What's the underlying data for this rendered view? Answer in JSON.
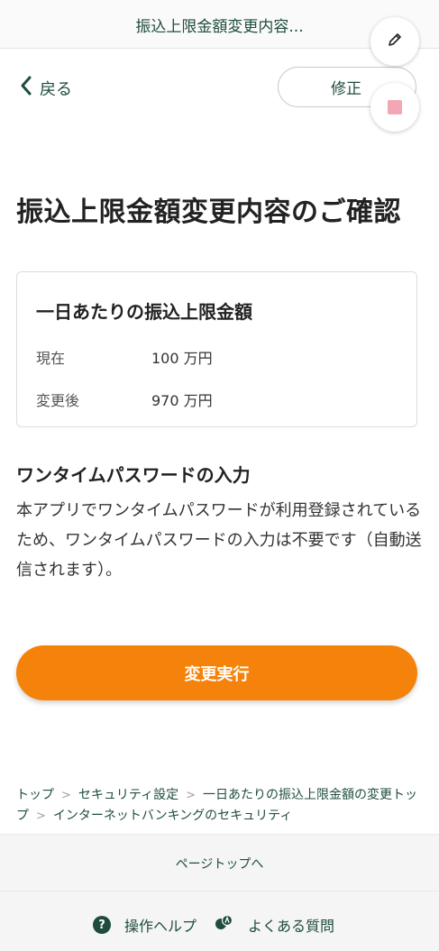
{
  "header": {
    "title": "振込上限金額変更内容...",
    "back_label": "戻る",
    "modify_label": "修正"
  },
  "main": {
    "page_title": "振込上限金額変更内容のご確認",
    "card": {
      "title": "一日あたりの振込上限金額",
      "rows": [
        {
          "label": "現在",
          "value": "100 万円"
        },
        {
          "label": "変更後",
          "value": "970 万円"
        }
      ]
    },
    "otp": {
      "title": "ワンタイムパスワードの入力",
      "body": "本アプリでワンタイムパスワードが利用登録されているため、ワンタイムパスワードの入力は不要です（自動送信されます）。"
    },
    "execute_label": "変更実行"
  },
  "breadcrumb": {
    "items": [
      "トップ",
      "セキュリティ設定",
      "一日あたりの振込上限金額の変更トップ",
      "インターネットバンキングのセキュリティ"
    ]
  },
  "footer": {
    "page_top_label": "ページトップへ",
    "help_label": "操作ヘルプ",
    "faq_label": "よくある質問"
  },
  "colors": {
    "brand_green": "#1f4d3c",
    "accent_orange": "#f5820a"
  },
  "icons": [
    "back-chevron-icon",
    "pencil-icon",
    "stop-icon",
    "chevron-right-icon",
    "help-icon",
    "faq-icon"
  ]
}
